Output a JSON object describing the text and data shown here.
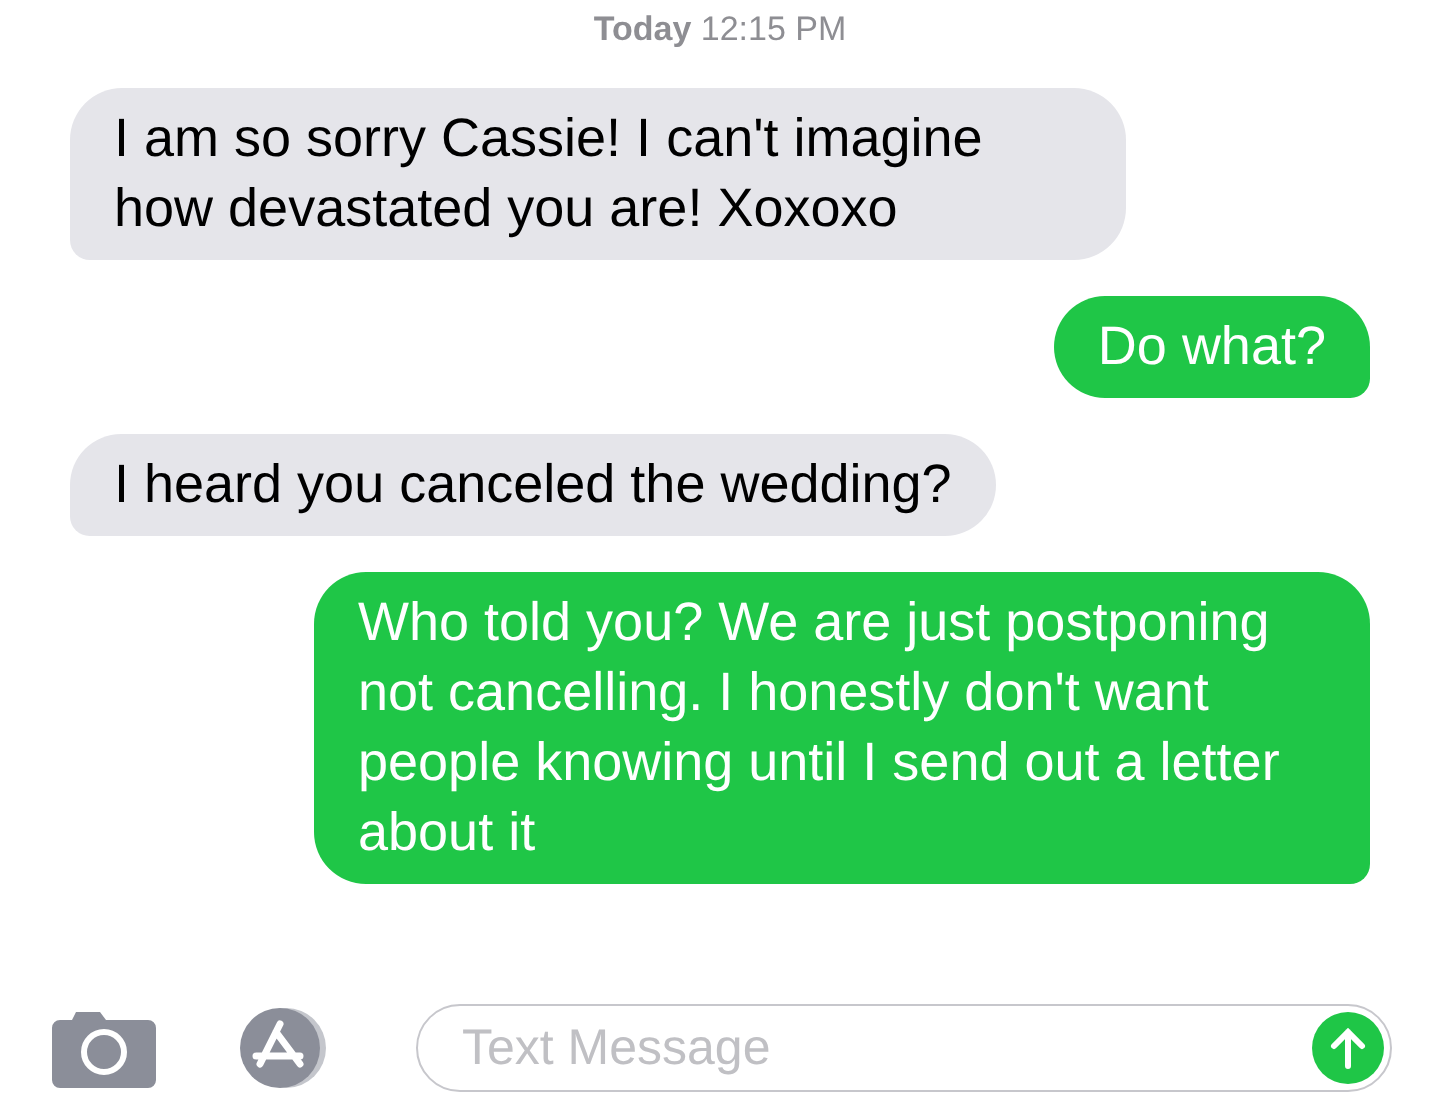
{
  "timestamp": "**Today** 12:15 PM",
  "messages": [
    {
      "kind": "received",
      "text": "I am so sorry Cassie! I can't imagine how devastated you are! Xoxoxo"
    },
    {
      "kind": "sent",
      "text": "Do what?"
    },
    {
      "kind": "received",
      "text": "I heard you canceled the wedding?"
    },
    {
      "kind": "sent",
      "text": "Who told you? We are just postponing not cancelling. I honestly don't want people knowing until I send out a letter about it"
    }
  ],
  "compose": {
    "placeholder": "Text Message"
  }
}
